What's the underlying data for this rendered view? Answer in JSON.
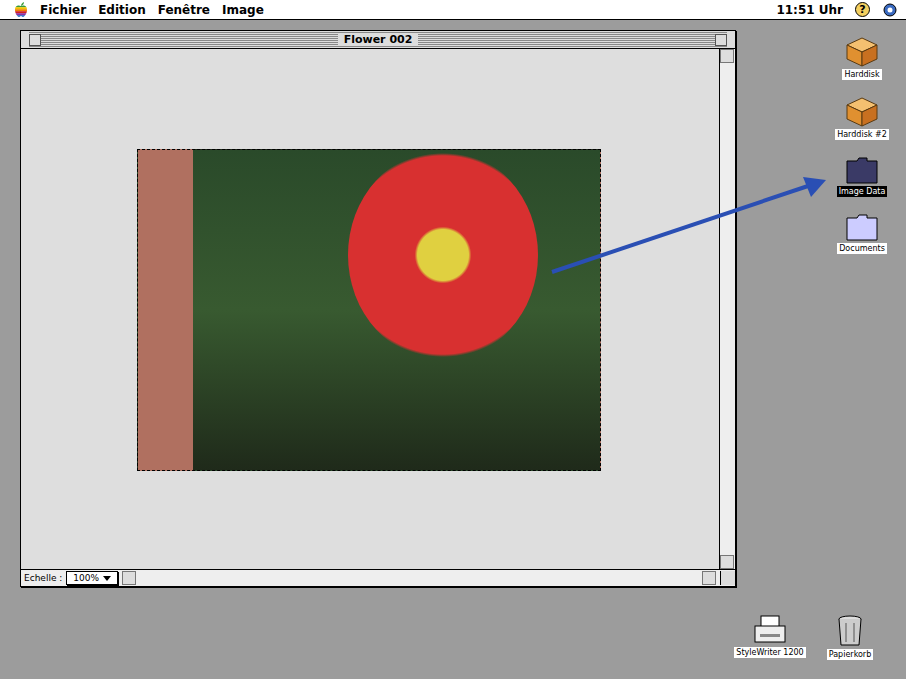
{
  "menu_bar": {
    "menus": [
      "Fichier",
      "Edition",
      "Fenêtre",
      "Image"
    ],
    "clock": "11:51 Uhr",
    "help": "?"
  },
  "window": {
    "title": "Flower 002",
    "scale_label": "Echelle :",
    "scale": "100%"
  },
  "desktop_icons": [
    {
      "label": "Harddisk",
      "kind": "disk",
      "selected": false
    },
    {
      "label": "Harddisk #2",
      "kind": "disk",
      "selected": false
    },
    {
      "label": "Image Data",
      "kind": "folder",
      "selected": true
    },
    {
      "label": "Documents",
      "kind": "folder",
      "selected": false
    },
    {
      "label": "StyleWriter 1200",
      "kind": "printer",
      "selected": false
    },
    {
      "label": "Papierkorb",
      "kind": "trash",
      "selected": false
    }
  ]
}
